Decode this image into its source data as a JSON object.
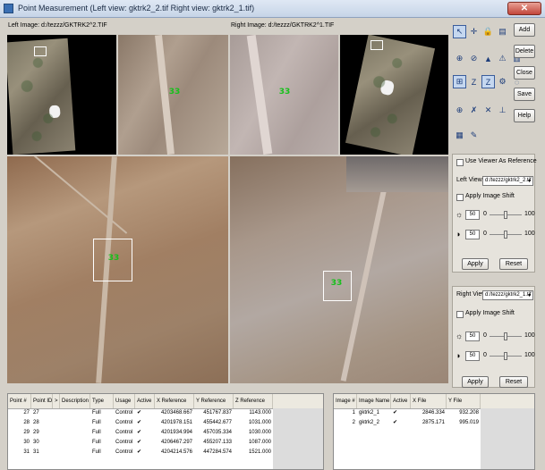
{
  "window": {
    "title": "Point Measurement (Left view: gktrk2_2.tif  Right view: gktrk2_1.tif)",
    "close_glyph": "✕"
  },
  "views": {
    "left_label": "Left Image: d:/tezzz/GKTRK2^2.TIF",
    "right_label": "Right Image: d:/tezzz/GKTRK2^1.TIF",
    "zoom_point_left": "33",
    "zoom_point_right": "33",
    "main_point_left": "33",
    "main_point_right": "33"
  },
  "toolbar": {
    "icons": [
      "select-arrow-icon",
      "crosshair-icon",
      "lock-icon",
      "table-icon",
      "undo-icon",
      "zoom-drive-icon",
      "link-icon",
      "triangle-icon",
      "warning-icon",
      "report-icon",
      "auto-measure-icon",
      "z-icon",
      "z-box-icon",
      "geometry-icon",
      "solve-icon",
      "color-icon",
      "x-icon",
      "cross-icon",
      "elevation-icon",
      "contrast-icon",
      "settings-icon",
      "export-icon"
    ],
    "glyphs": [
      "↖",
      "✛",
      "🔒",
      "▤",
      "↶",
      "⊕",
      "⊘",
      "▲",
      "⚠",
      "▥",
      "⊞",
      "Z",
      "Z",
      "⚙",
      "◌",
      "⊕",
      "✗",
      "✕",
      "⊥",
      "◑",
      "▦",
      "✎"
    ]
  },
  "side_buttons": [
    "Add",
    "Delete",
    "Close",
    "Save",
    "Help"
  ],
  "left_controls": {
    "use_viewer_as_reference": "Use Viewer As Reference",
    "left_view_label": "Left View:",
    "left_view_value": "d:/tezzz/gktrk2_2.tif",
    "apply_image_shift": "Apply Image Shift",
    "brightness": "50",
    "brightness_min": "0",
    "brightness_max": "100",
    "contrast": "50",
    "contrast_min": "0",
    "contrast_max": "100",
    "apply": "Apply",
    "reset": "Reset"
  },
  "right_controls": {
    "right_view_label": "Right View:",
    "right_view_value": "d:/tezzz/gktrk2_1.tif",
    "apply_image_shift": "Apply Image Shift",
    "brightness": "50",
    "brightness_min": "0",
    "brightness_max": "100",
    "contrast": "50",
    "contrast_min": "0",
    "contrast_max": "100",
    "apply": "Apply",
    "reset": "Reset"
  },
  "points_table": {
    "headers": [
      "Point #",
      "Point ID",
      ">",
      "Description",
      "Type",
      "Usage",
      "Active",
      "X Reference",
      "Y Reference",
      "Z Reference"
    ],
    "rows": [
      [
        "27",
        "27",
        "",
        "",
        "Full",
        "Control",
        "✔",
        "4203468.667",
        "451767.837",
        "1143.000"
      ],
      [
        "28",
        "28",
        "",
        "",
        "Full",
        "Control",
        "✔",
        "4201978.151",
        "455442.677",
        "1031.000"
      ],
      [
        "29",
        "29",
        "",
        "",
        "Full",
        "Control",
        "✔",
        "4201934.994",
        "457035.334",
        "1030.000"
      ],
      [
        "30",
        "30",
        "",
        "",
        "Full",
        "Control",
        "✔",
        "4206467.297",
        "455207.133",
        "1087.000"
      ],
      [
        "31",
        "31",
        "",
        "",
        "Full",
        "Control",
        "✔",
        "4204214.576",
        "447284.574",
        "1521.000"
      ]
    ]
  },
  "images_table": {
    "headers": [
      "Image #",
      "Image Name",
      "Active",
      "X File",
      "Y File"
    ],
    "rows": [
      [
        "1",
        "gktrk2_1",
        "✔",
        "2846.334",
        "932.208"
      ],
      [
        "2",
        "gktrk2_2",
        "✔",
        "2875.171",
        "995.019"
      ]
    ]
  }
}
